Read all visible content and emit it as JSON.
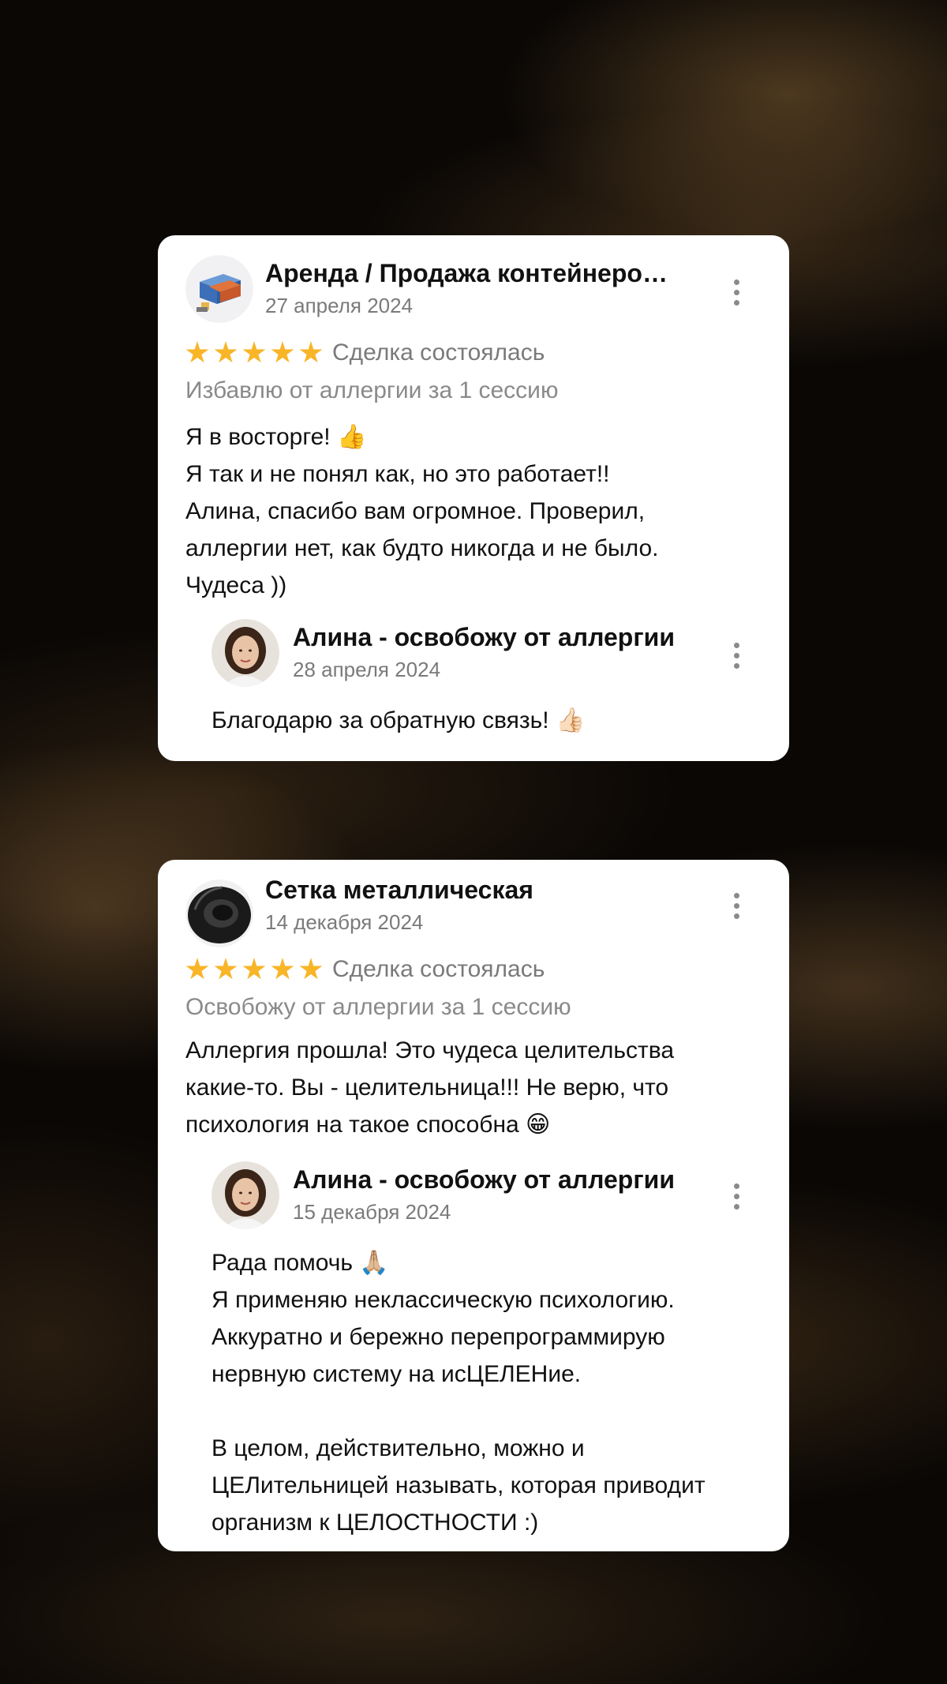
{
  "reviews": [
    {
      "author": "Аренда / Продажа контейнеро…",
      "avatar_icon": "container-logo-icon",
      "date": "27 апреля 2024",
      "stars": 5,
      "status": "Сделка состоялась",
      "service": "Избавлю от аллергии за 1 сессию",
      "lines": [
        "Я в восторге! 👍",
        "Я так и не понял как, но это работает!!",
        "Алина, спасибо вам огромное.  Проверил,",
        "аллергии нет, как будто никогда и не было.",
        "Чудеса ))"
      ],
      "reply": {
        "author": "Алина - освобожу от аллергии",
        "date": "28 апреля 2024",
        "lines": [
          "Благодарю за обратную связь! 👍🏻"
        ]
      }
    },
    {
      "author": "Сетка металлическая",
      "avatar_icon": "tire-icon",
      "date": "14 декабря 2024",
      "stars": 5,
      "status": "Сделка состоялась",
      "service": "Освобожу от аллергии за 1 сессию",
      "lines": [
        "Аллергия прошла! Это чудеса целительства",
        "какие-то. Вы - целительница!!! Не верю, что",
        "психология на такое способна 😁"
      ],
      "reply": {
        "author": "Алина - освобожу от аллергии",
        "date": "15 декабря 2024",
        "lines": [
          "Рада помочь 🙏🏼",
          "Я применяю неклассическую психологию.",
          "Аккуратно и бережно перепрограммирую",
          "нервную систему на исЦЕЛЕНие.",
          "",
          "В целом, действительно, можно и",
          "ЦЕЛительницей называть, которая приводит",
          "организм к ЦЕЛОСТНОСТИ :)"
        ]
      }
    }
  ],
  "colors": {
    "star": "#f8b527",
    "card": "#ffffff",
    "muted_text": "#7a7a7a",
    "background": "#0a0705",
    "accent_gold": "#c89a55"
  }
}
